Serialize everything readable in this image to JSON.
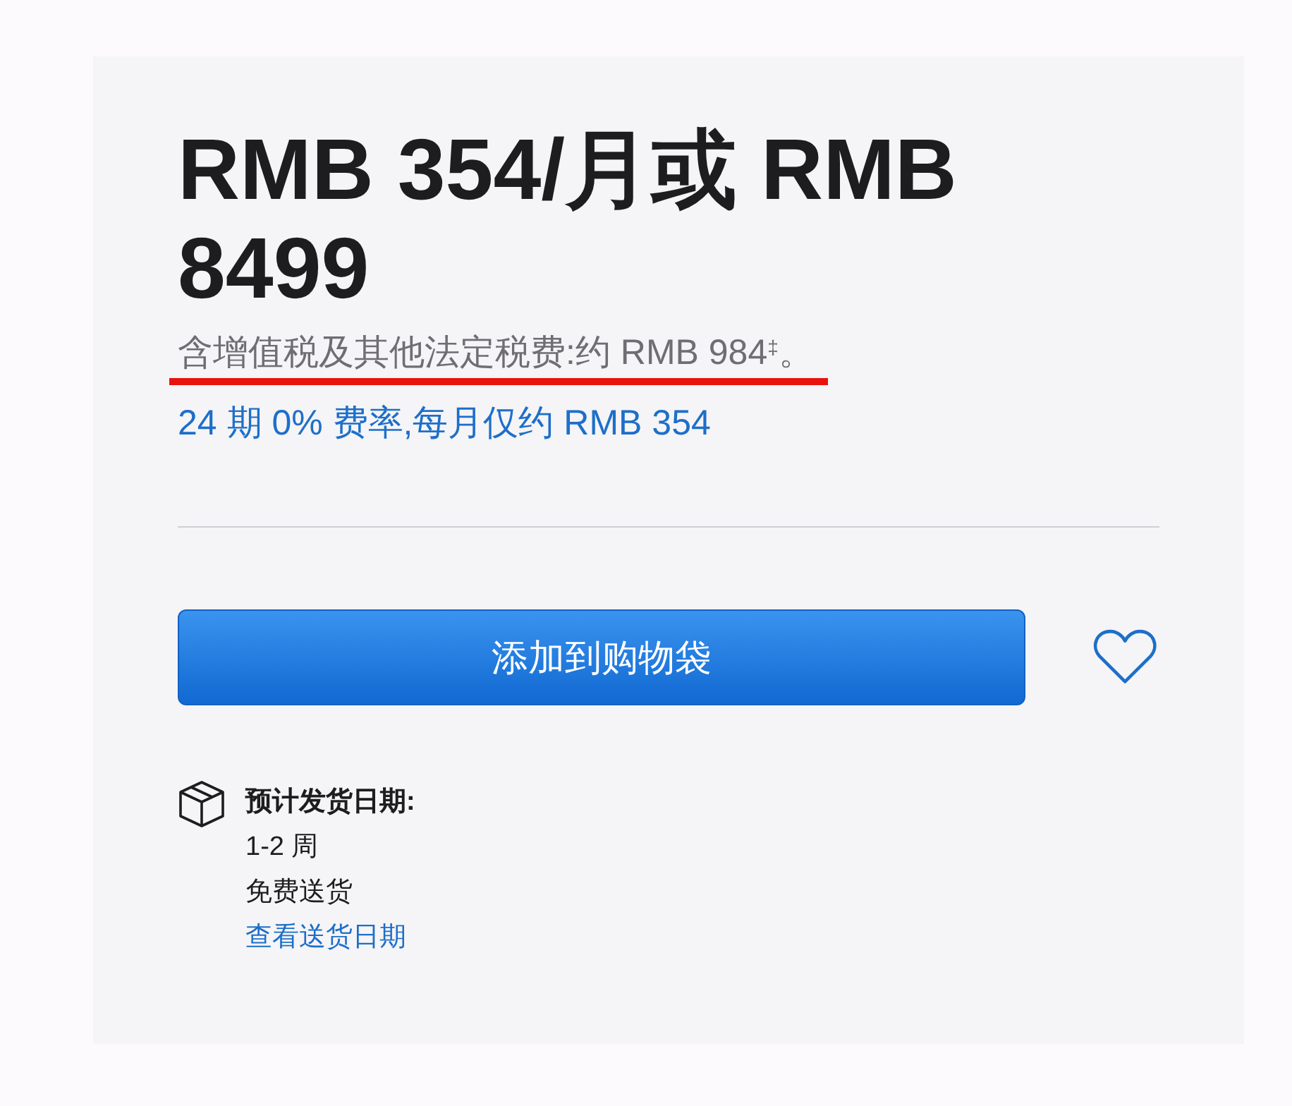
{
  "price": {
    "title": "RMB 354/月或 RMB 8499",
    "tax_note": {
      "text": "含增值税及其他法定税费:约 RMB 984$^{‡}$。",
      "underlined": true
    },
    "installment_link": "24 期 0% 费率,每月仅约 RMB 354"
  },
  "add_to_bag_button": "添加到购物袋",
  "delivery": {
    "heading": "预计发货日期:",
    "lines": [
      "1-2 周",
      "免费送货"
    ],
    "link": "查看送货日期"
  }
}
